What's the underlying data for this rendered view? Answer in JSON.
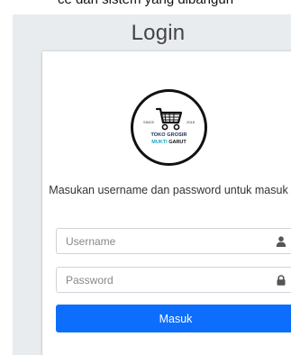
{
  "page": {
    "caption_top": "ce dari sistem yang dibangun",
    "title": "Login"
  },
  "logo": {
    "since": "SINCE",
    "year": "2018",
    "name_line1": "TOKO GROSIR",
    "name_line2_a": "MUKTI",
    "name_line2_b": "GARUT",
    "colors": {
      "ring": "#111111",
      "name": "#1a2a5a",
      "highlight": "#1aa7c8"
    }
  },
  "login": {
    "message": "Masukan username dan password untuk masuk",
    "username": {
      "value": "",
      "placeholder": "Username",
      "icon": "user-icon"
    },
    "password": {
      "value": "",
      "placeholder": "Password",
      "icon": "lock-icon"
    },
    "submit_label": "Masuk"
  },
  "colors": {
    "background": "#e9ecef",
    "primary": "#0d6efd"
  }
}
